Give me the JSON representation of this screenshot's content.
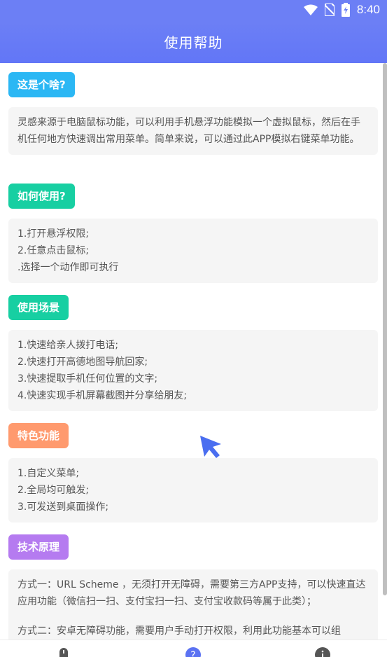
{
  "status": {
    "time": "8:40"
  },
  "header": {
    "title": "使用帮助"
  },
  "sections": [
    {
      "title": "这是个啥?",
      "lines": [
        "灵感来源于电脑鼠标功能，可以利用手机悬浮功能模拟一个虚拟鼠标，然后在手机任何地方快速调出常用菜单。简单来说，可以通过此APP模拟右键菜单功能。"
      ]
    },
    {
      "title": "如何使用?",
      "lines": [
        "1.打开悬浮权限;",
        "2.任意点击鼠标;",
        ".选择一个动作即可执行"
      ]
    },
    {
      "title": "使用场景",
      "lines": [
        "1.快速给亲人拨打电话;",
        "2.快速打开高德地图导航回家;",
        "3.快速提取手机任何位置的文字;",
        "4.快速实现手机屏幕截图并分享给朋友;"
      ]
    },
    {
      "title": "特色功能",
      "lines": [
        "1.自定义菜单;",
        "2.全局均可触发;",
        "3.可发送到桌面操作;"
      ]
    },
    {
      "title": "技术原理",
      "lines": [
        "方式一：URL Scheme ，无须打开无障碍，需要第三方APP支持，可以快速直达应用功能（微信扫一扫、支付宝扫一扫、支付宝收款码等属于此类）；",
        "",
        " 方式二：安卓无障碍功能，需要用户手动打开权限，利用此功能基本可以组"
      ]
    }
  ],
  "colors": {
    "s0": "#2bb7f4",
    "s1": "#17cfa2",
    "s2": "#17cfa2",
    "s3": "#ff9a6e",
    "s4": "#b57bf0",
    "accent": "#5b72f2"
  }
}
